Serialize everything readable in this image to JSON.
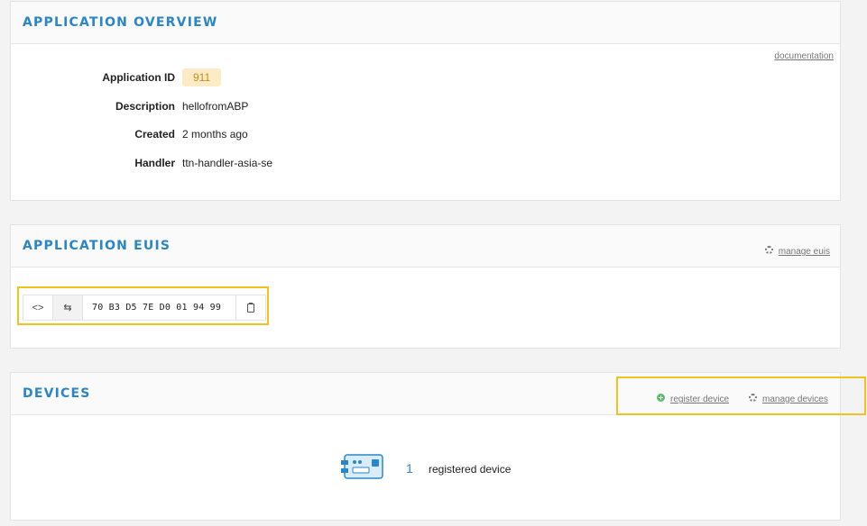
{
  "overview": {
    "title": "APPLICATION OVERVIEW",
    "documentation_link": "documentation",
    "fields": [
      {
        "label": "Application ID",
        "value": "911"
      },
      {
        "label": "Description",
        "value": "hellofromABP"
      },
      {
        "label": "Created",
        "value": "2 months ago"
      },
      {
        "label": "Handler",
        "value": "ttn-handler-asia-se"
      }
    ]
  },
  "euis": {
    "title": "APPLICATION EUIS",
    "manage_link": "manage euis",
    "eui_value": "70 B3 D5 7E D0 01 94 99",
    "code_toggle_icon": "<>",
    "swap_icon": "⇆"
  },
  "devices": {
    "title": "DEVICES",
    "register_link": "register device",
    "manage_link": "manage devices",
    "count": "1",
    "count_label": "registered device"
  },
  "colors": {
    "accent": "#2a86c8",
    "highlight": "#f3c21f",
    "badge_bg": "#fdebc6",
    "badge_text": "#c98a1a",
    "success": "#59c06a"
  },
  "icons": {
    "settings": "gear-icon",
    "add": "plus-circle-icon",
    "copy": "clipboard-icon",
    "device": "device-board-icon"
  }
}
